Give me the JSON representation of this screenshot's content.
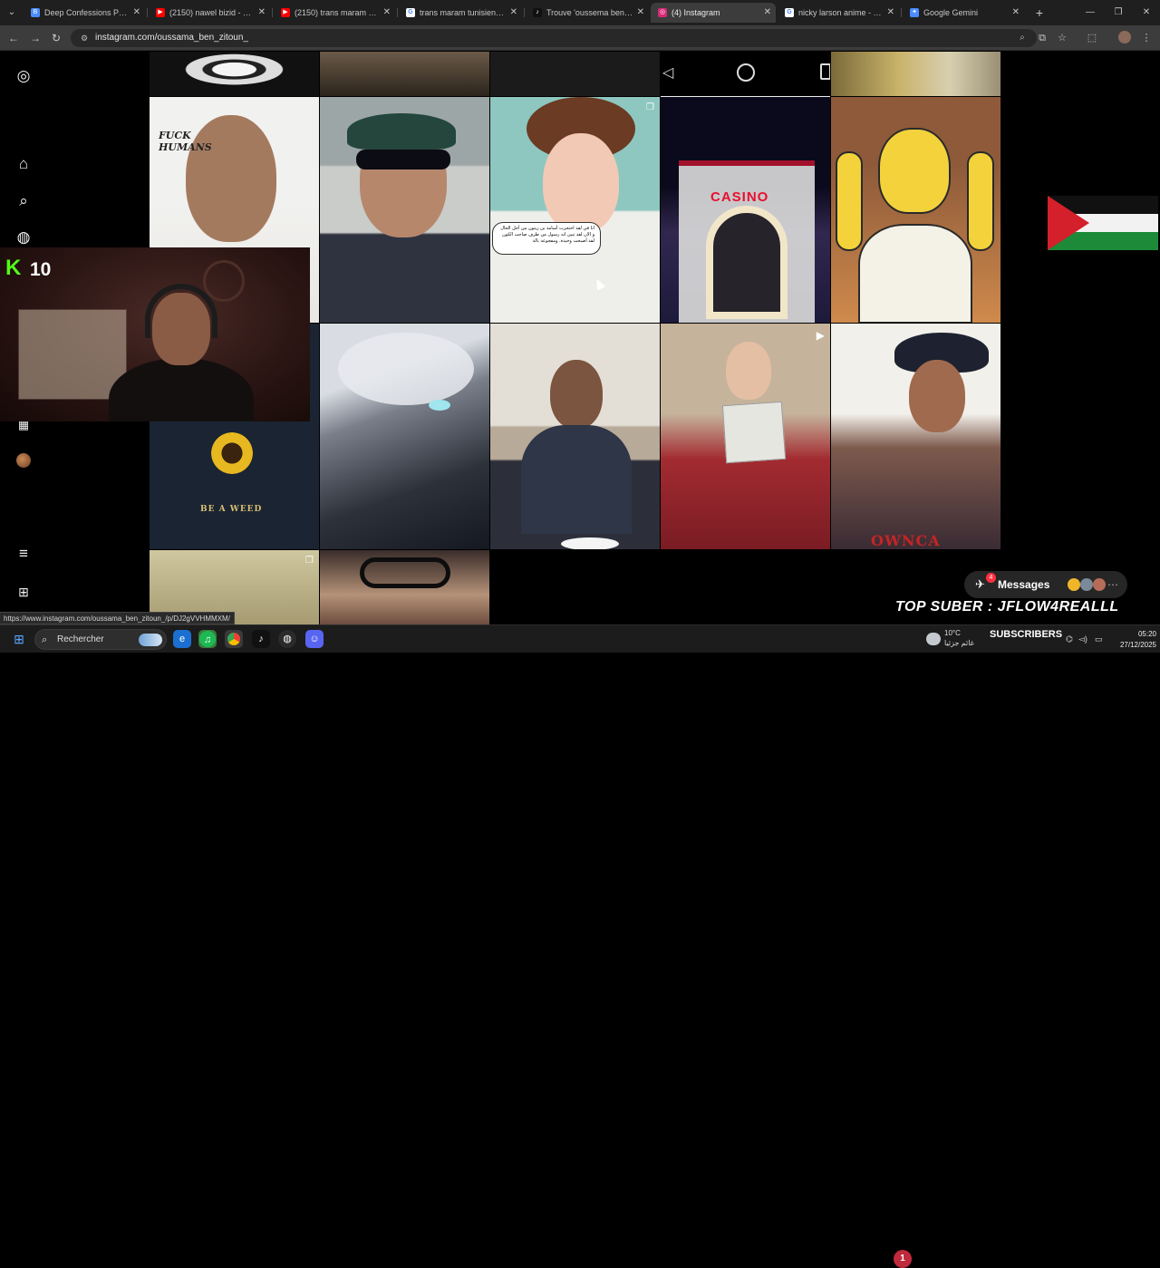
{
  "browser": {
    "tabs": [
      {
        "label": "Deep Confessions Podca",
        "favicon": "tab-favicon-generic",
        "favicon_color": "#4a8cff"
      },
      {
        "label": "(2150) nawel bizid - YouT",
        "favicon": "youtube-icon",
        "favicon_color": "#ff0000"
      },
      {
        "label": "(2150) trans maram tunisi",
        "favicon": "youtube-icon",
        "favicon_color": "#ff0000"
      },
      {
        "label": "trans maram tunisien - Go",
        "favicon": "google-icon",
        "favicon_color": "#ffffff"
      },
      {
        "label": "Trouve 'oussema ben zito",
        "favicon": "tiktok-icon",
        "favicon_color": "#111111"
      },
      {
        "label": "(4) Instagram",
        "favicon": "instagram-icon",
        "favicon_color": "#d62976",
        "active": true
      },
      {
        "label": "nicky larson anime - Goo",
        "favicon": "google-icon",
        "favicon_color": "#ffffff"
      },
      {
        "label": "Google Gemini",
        "favicon": "gemini-icon",
        "favicon_color": "#4a8cff"
      }
    ],
    "url": "instagram.com/oussama_ben_zitoun_",
    "status_link": "https://www.instagram.com/oussama_ben_zitoun_/p/DJ2gVVHMMXM/"
  },
  "instagram": {
    "sidebar_icons": [
      "instagram-logo-icon",
      "home-icon",
      "search-icon",
      "explore-icon",
      "reels-icon",
      "profile-avatar",
      "menu-icon",
      "apps-icon"
    ],
    "posts": {
      "text_fuck_humans": "FUCK\nHUMANS",
      "speech_bubble": "انا في لقد احتجرت أسامة بن زيتون من أجل الحال و الان لقد تبين انه رسول من طرف صاحب الكون لقد أصبحت وحيدة. ومفجوعة بالة",
      "casino_sign": "CASINO",
      "shirt_text": "BE A WEED",
      "banner_text": "OWNCA"
    }
  },
  "overlays": {
    "kick_logo": "K",
    "kick_count": "10",
    "messages_label": "Messages",
    "messages_badge": "4",
    "top_suber": "TOP SUBER : JFLOW4REALLL",
    "subs_badge": "1",
    "subs_label": "SUBSCRIBERS"
  },
  "taskbar": {
    "search_label": "Rechercher",
    "apps": [
      "edge-icon",
      "chrome-dev-icon",
      "spotify-icon",
      "chrome-icon",
      "tiktok-icon",
      "obs-icon",
      "discord-icon"
    ],
    "weather_temp": "10°C",
    "weather_desc": "غائم جزئيا",
    "time": "05:20",
    "date": "27/12/2025"
  }
}
